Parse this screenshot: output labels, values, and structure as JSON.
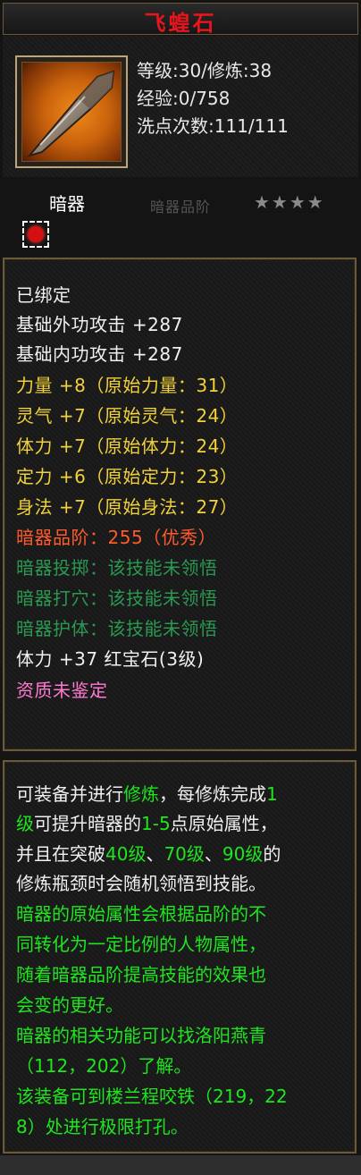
{
  "title": "飞蝗石",
  "header": {
    "level": "等级:30/修炼:38",
    "exp": "经验:0/758",
    "wash": "洗点次数:111/111"
  },
  "item_type": "暗器",
  "faded_label": "暗器品阶",
  "stars": "★★★★",
  "attrs": [
    {
      "text": "已绑定",
      "color": "w"
    },
    {
      "text": "基础外功攻击 +287",
      "color": "w"
    },
    {
      "text": "基础内功攻击 +287",
      "color": "w"
    },
    {
      "text": "力量 +8（原始力量：31）",
      "color": "y"
    },
    {
      "text": "灵气 +7（原始灵气：24）",
      "color": "y"
    },
    {
      "text": "体力 +7（原始体力：24）",
      "color": "y"
    },
    {
      "text": "定力 +6（原始定力：23）",
      "color": "y"
    },
    {
      "text": "身法 +7（原始身法：27）",
      "color": "y"
    },
    {
      "text": "暗器品阶：255（优秀）",
      "color": "o"
    },
    {
      "text": "暗器投掷：该技能未领悟",
      "color": "g"
    },
    {
      "text": "暗器打穴：该技能未领悟",
      "color": "g"
    },
    {
      "text": "暗器护体：该技能未领悟",
      "color": "g"
    },
    {
      "text": "体力 +37 红宝石(3级)",
      "color": "w"
    },
    {
      "text": "资质未鉴定",
      "color": "p"
    }
  ],
  "desc": {
    "l1a": "可装备并进行",
    "l1b": "修炼",
    "l1c": "，每修炼完成",
    "l1d": "1",
    "l2a": "级",
    "l2b": "可提升暗器的",
    "l2c": "1-5",
    "l2d": "点原始属性，",
    "l3a": "并且在突破",
    "l3b": "40级",
    "l3c": "、",
    "l3d": "70级",
    "l3e": "、",
    "l3f": "90级",
    "l3g": "的",
    "l4": "修炼瓶颈时会随机领悟到技能。",
    "l5": "暗器的原始属性会根据品阶的不",
    "l6": "同转化为一定比例的人物属性，",
    "l7": "随着暗器品阶提高技能的效果也",
    "l8": "会变的更好。",
    "l9": "暗器的相关功能可以找洛阳燕青",
    "l10": "（112，202）了解。",
    "l11": "该装备可到楼兰程咬铁（219，22",
    "l12": "8）处进行极限打孔。"
  },
  "colors": {
    "title": "#e8151c",
    "yellow": "#f2d23a",
    "orange": "#ff5a2a",
    "green_dim": "#2a9a52",
    "green_bright": "#1ee61e",
    "pink": "#ff7ad0",
    "border": "#6b5a3a"
  }
}
